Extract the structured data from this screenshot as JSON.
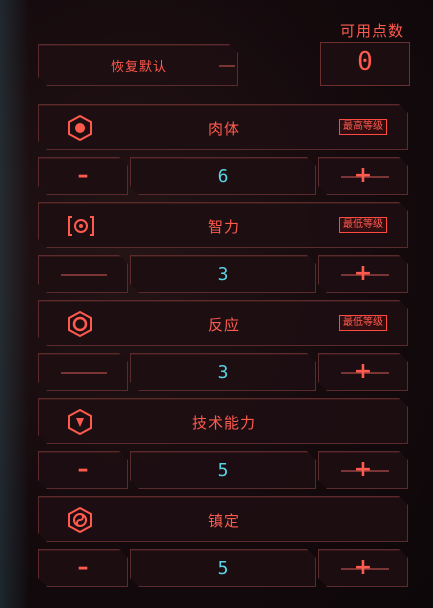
{
  "header": {
    "reset_label": "恢复默认",
    "available_points_label": "可用点数",
    "available_points_value": "0"
  },
  "attributes": [
    {
      "name": "肉体",
      "value": "6",
      "badge": "最高等级",
      "icon": "body-icon"
    },
    {
      "name": "智力",
      "value": "3",
      "badge": "最低等级",
      "icon": "intelligence-icon"
    },
    {
      "name": "反应",
      "value": "3",
      "badge": "最低等级",
      "icon": "reflexes-icon"
    },
    {
      "name": "技术能力",
      "value": "5",
      "badge": "",
      "icon": "technical-ability-icon"
    },
    {
      "name": "镇定",
      "value": "5",
      "badge": "",
      "icon": "cool-icon"
    }
  ],
  "controls": {
    "minus_label": "–",
    "plus_label": "+"
  },
  "colors": {
    "accent": "#ff5a4e",
    "value": "#58d4e6",
    "panel": "#1c0e11",
    "border": "#5a2a2c"
  }
}
